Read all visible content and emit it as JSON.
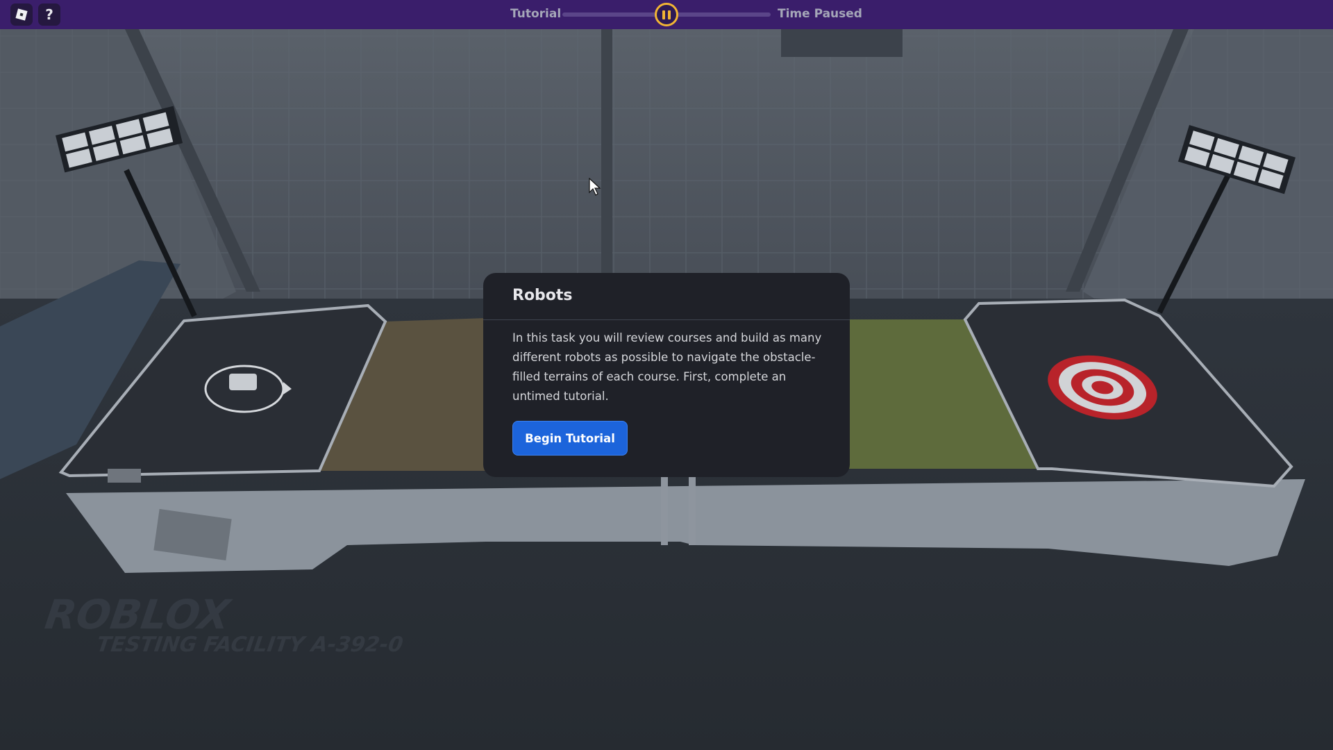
{
  "topbar": {
    "roblox_icon": "roblox-logo-icon",
    "help_icon": "question-mark-icon",
    "help_glyph": "?",
    "tutorial_label": "Tutorial",
    "status_label": "Time Paused",
    "pause_icon": "pause-icon",
    "progress_fraction": 0.5
  },
  "modal": {
    "title": "Robots",
    "body": "In this task you will review courses and build as many different robots as possible to navigate the obstacle-filled terrains of each course. First, complete an untimed tutorial.",
    "button_label": "Begin Tutorial"
  },
  "scene": {
    "floor_text_line1": "ROBLOX",
    "floor_text_line2": "TESTING FACILITY A-392-0"
  },
  "colors": {
    "topbar_bg": "#3a1e6b",
    "pause_accent": "#f2b534",
    "button_blue": "#1c64db",
    "modal_bg": "#1f2128"
  }
}
